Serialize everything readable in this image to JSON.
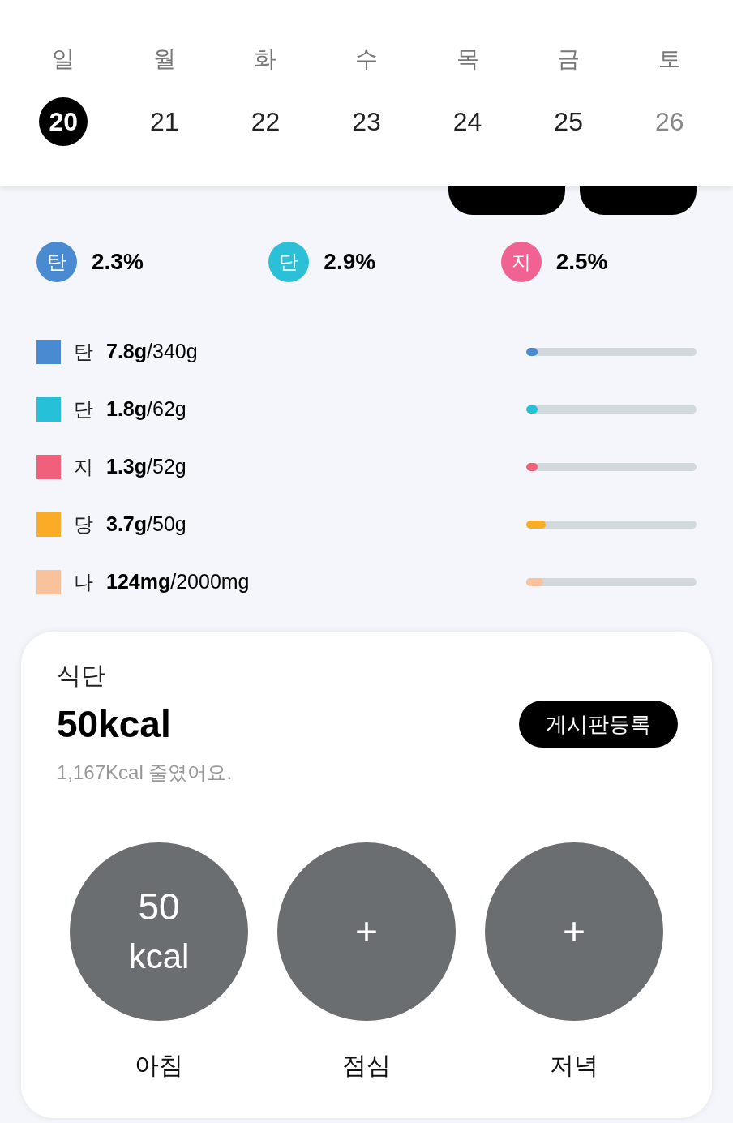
{
  "calendar": {
    "weekdays": [
      "일",
      "월",
      "화",
      "수",
      "목",
      "금",
      "토"
    ],
    "dates": [
      {
        "label": "20",
        "selected": true,
        "dimmed": false
      },
      {
        "label": "21",
        "selected": false,
        "dimmed": false
      },
      {
        "label": "22",
        "selected": false,
        "dimmed": false
      },
      {
        "label": "23",
        "selected": false,
        "dimmed": false
      },
      {
        "label": "24",
        "selected": false,
        "dimmed": false
      },
      {
        "label": "25",
        "selected": false,
        "dimmed": false
      },
      {
        "label": "26",
        "selected": false,
        "dimmed": true
      }
    ]
  },
  "ratios": [
    {
      "label": "탄",
      "value": "2.3%",
      "color": "#4a8ad0"
    },
    {
      "label": "단",
      "value": "2.9%",
      "color": "#2bc0d8"
    },
    {
      "label": "지",
      "value": "2.5%",
      "color": "#f06292"
    }
  ],
  "nutrients": [
    {
      "label": "탄",
      "amount": "7.8g",
      "goal": "/340g",
      "color": "#4a8ad0",
      "level": 0.067
    },
    {
      "label": "단",
      "amount": "1.8g",
      "goal": "/62g",
      "color": "#26c1d9",
      "level": 0.067
    },
    {
      "label": "지",
      "amount": "1.3g",
      "goal": "/52g",
      "color": "#f0607a",
      "level": 0.067
    },
    {
      "label": "당",
      "amount": "3.7g",
      "goal": "/50g",
      "color": "#fbac26",
      "level": 0.114
    },
    {
      "label": "나",
      "amount": "124mg",
      "goal": "/2000mg",
      "color": "#f7c29c",
      "level": 0.1
    }
  ],
  "diet": {
    "title": "식단",
    "total": "50kcal",
    "board_button": "게시판등록",
    "note": "1,167Kcal 줄였어요.",
    "meals": [
      {
        "label": "아침",
        "kind": "value",
        "value": "50",
        "unit": "kcal"
      },
      {
        "label": "점심",
        "kind": "add",
        "symbol": "+"
      },
      {
        "label": "저녁",
        "kind": "add",
        "symbol": "+"
      }
    ]
  }
}
